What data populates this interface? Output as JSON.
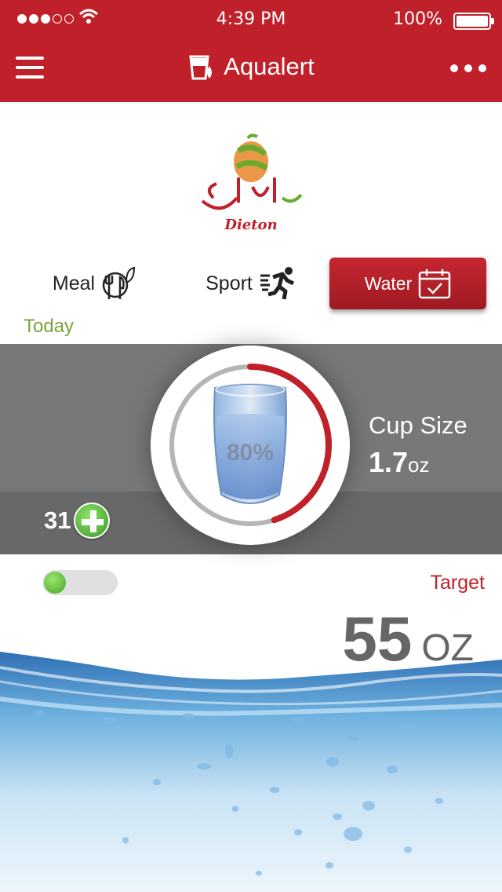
{
  "status_bar": {
    "time": "4:39 PM",
    "battery": "100%",
    "signal_dots_filled": 3,
    "signal_dots_total": 5
  },
  "header": {
    "title": "Aqualert",
    "menu_icon": "hamburger-icon",
    "more_icon": "more-dots-icon",
    "title_icon": "glass-drop-icon"
  },
  "logo": {
    "caption": "Dieton",
    "arabic": "دايتون"
  },
  "tabs": [
    {
      "label": "Meal",
      "icon": "meal-icon",
      "active": false
    },
    {
      "label": "Sport",
      "icon": "running-icon",
      "active": false
    },
    {
      "label": "Water",
      "icon": "calendar-check-icon",
      "active": true
    }
  ],
  "today_label": "Today",
  "progress": {
    "percent_label": "80%",
    "value": 0.45
  },
  "cup": {
    "label": "Cup Size",
    "value": "1.7",
    "unit": "oz"
  },
  "count": "31",
  "target": {
    "label": "Target",
    "value": "55",
    "unit": "OZ"
  },
  "toggle_on": true,
  "colors": {
    "brand": "#c0202a",
    "today": "#7da23a",
    "band": "#777879",
    "water": "#5aa8d8"
  }
}
